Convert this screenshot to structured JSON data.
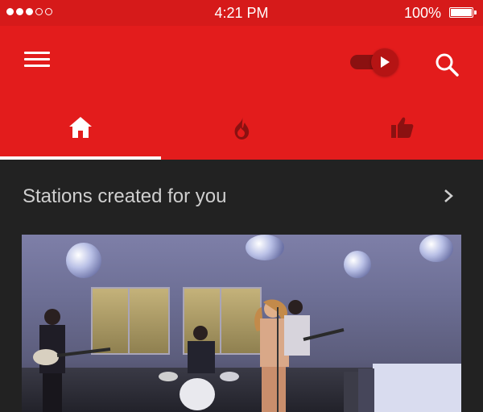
{
  "status_bar": {
    "time": "4:21 PM",
    "battery": "100%",
    "signal_dots_filled": 3,
    "signal_dots_total": 5
  },
  "app_bar": {
    "icons": [
      "menu-icon",
      "music-toggle-icon",
      "search-icon"
    ]
  },
  "tabs": [
    {
      "name": "home",
      "icon": "home-icon",
      "selected": true
    },
    {
      "name": "trending",
      "icon": "flame-icon",
      "selected": false
    },
    {
      "name": "liked",
      "icon": "thumbs-up-icon",
      "selected": false
    }
  ],
  "section": {
    "title": "Stations created for you"
  },
  "colors": {
    "status_bar": "#d61a1a",
    "app_bar": "#e31c1c",
    "background": "#222222",
    "tab_icon_selected": "#ffffff",
    "tab_icon_unselected": "#8b1111"
  }
}
